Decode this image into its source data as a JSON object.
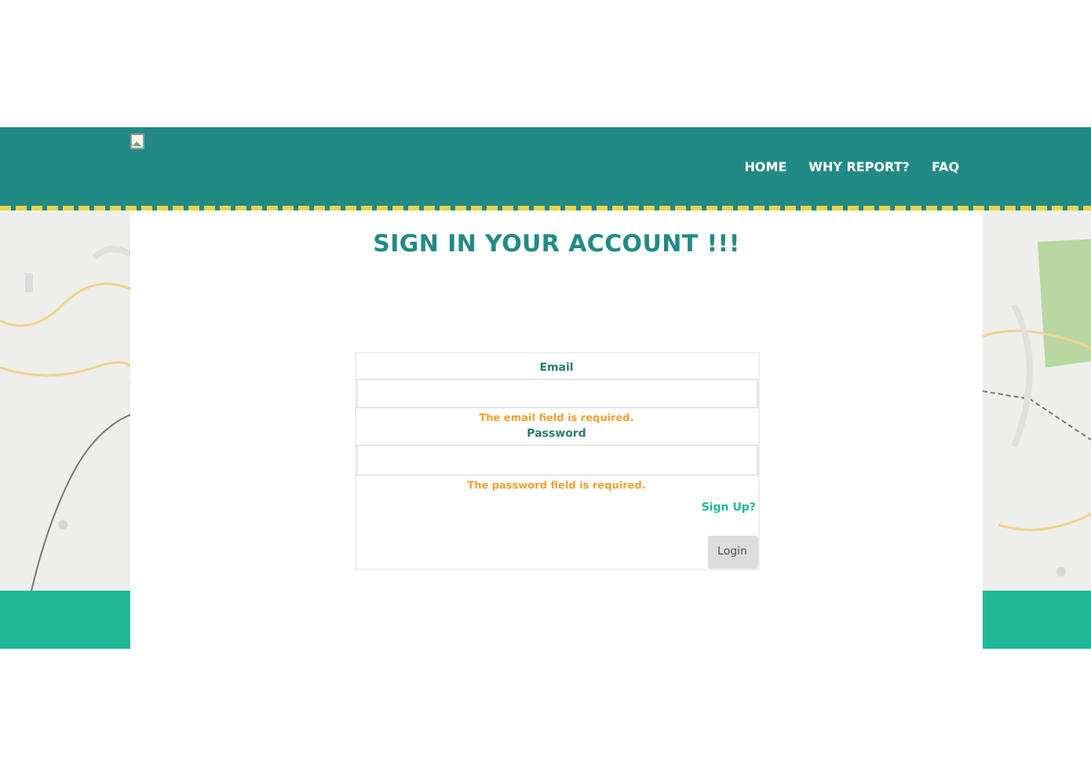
{
  "header": {
    "nav": [
      {
        "label": "HOME"
      },
      {
        "label": "WHY REPORT?"
      },
      {
        "label": "FAQ"
      }
    ]
  },
  "page_title": "SIGN IN YOUR ACCOUNT !!!",
  "form": {
    "fields": [
      {
        "label": "Email",
        "error": "The email field is required."
      },
      {
        "label": "Password",
        "error": "The password field is required."
      }
    ],
    "signup_link": "Sign Up?",
    "submit": "Login"
  }
}
